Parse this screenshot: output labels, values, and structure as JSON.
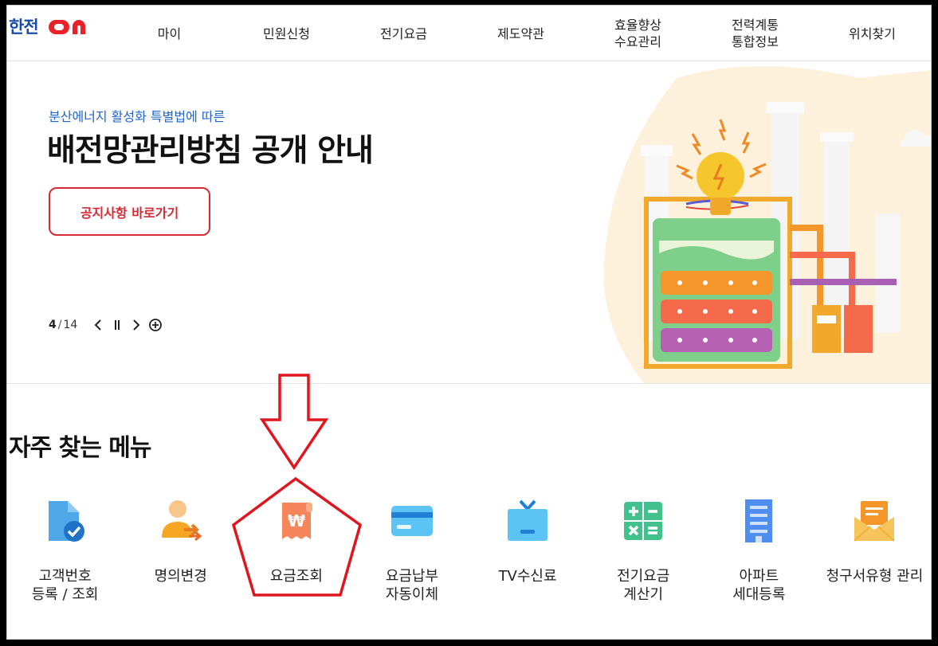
{
  "header": {
    "logo": "한전ON",
    "nav": [
      "마이",
      "민원신청",
      "전기요금",
      "제도약관",
      "효율향상\n수요관리",
      "전력계통\n통합정보",
      "위치찾기"
    ]
  },
  "hero": {
    "subtitle": "분산에너지 활성화 특별법에 따른",
    "title": "배전망관리방침 공개 안내",
    "button_label": "공지사항 바로가기",
    "pager": {
      "current": "4",
      "separator": "/",
      "total": "14"
    }
  },
  "frequent_menu": {
    "title": "자주 찾는 메뉴",
    "items": [
      {
        "label": "고객번호\n등록 / 조회",
        "icon": "document-check-icon"
      },
      {
        "label": "명의변경",
        "icon": "person-transfer-icon"
      },
      {
        "label": "요금조회",
        "icon": "receipt-won-icon"
      },
      {
        "label": "요금납부\n자동이체",
        "icon": "credit-card-icon"
      },
      {
        "label": "TV수신료",
        "icon": "tv-icon"
      },
      {
        "label": "전기요금\n계산기",
        "icon": "calculator-icon"
      },
      {
        "label": "아파트\n세대등록",
        "icon": "apartment-icon"
      },
      {
        "label": "청구서유형 관리",
        "icon": "envelope-icon"
      }
    ]
  },
  "colors": {
    "brand_blue": "#1a4da8",
    "accent_red": "#d52b35",
    "subtitle_blue": "#1f64c9",
    "annotation_red": "#e0161e"
  }
}
